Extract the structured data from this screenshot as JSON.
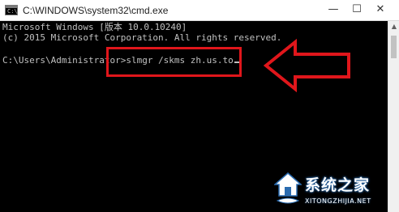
{
  "window": {
    "title": "C:\\WINDOWS\\system32\\cmd.exe",
    "icon_text": "C:\\",
    "controls": {
      "minimize": "—",
      "maximize": "☐",
      "close": "✕"
    }
  },
  "console": {
    "lines": [
      "Microsoft Windows [版本 10.0.10240]",
      "(c) 2015 Microsoft Corporation. All rights reserved.",
      "",
      "C:\\Users\\Administrator>slmgr /skms zh.us.to"
    ],
    "prompt": "C:\\Users\\Administrator>",
    "command": "slmgr /skms zh.us.to"
  },
  "annotation": {
    "box_color": "#e0161b",
    "arrow_color": "#e0161b",
    "arrow_direction": "left"
  },
  "watermark": {
    "text": "系统之家",
    "url": "XITONGZHIJIA.NET",
    "logo_icon": "house-logo-icon"
  },
  "colors": {
    "console_bg": "#000000",
    "console_fg": "#c0c0c0",
    "titlebar_bg": "#ffffff"
  }
}
